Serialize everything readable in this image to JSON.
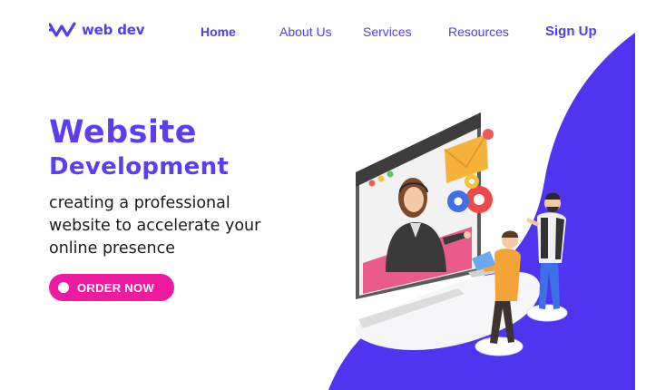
{
  "brand": {
    "name": "web dev",
    "icon": "w-logo-icon",
    "color": "#4f3df2"
  },
  "nav": {
    "items": [
      {
        "label": "Home",
        "active": true
      },
      {
        "label": "About Us",
        "active": false
      },
      {
        "label": "Services",
        "active": false
      },
      {
        "label": "Resources",
        "active": false
      }
    ],
    "signup_label": "Sign Up"
  },
  "hero": {
    "title": "Website",
    "subtitle": "Development",
    "description": "creating a professional website to accelerate your online presence",
    "cta_label": "ORDER NOW"
  },
  "colors": {
    "accent": "#5a3ff2",
    "cta": "#ee1ba0",
    "text": "#1a1a1a",
    "background": "#ffffff"
  }
}
